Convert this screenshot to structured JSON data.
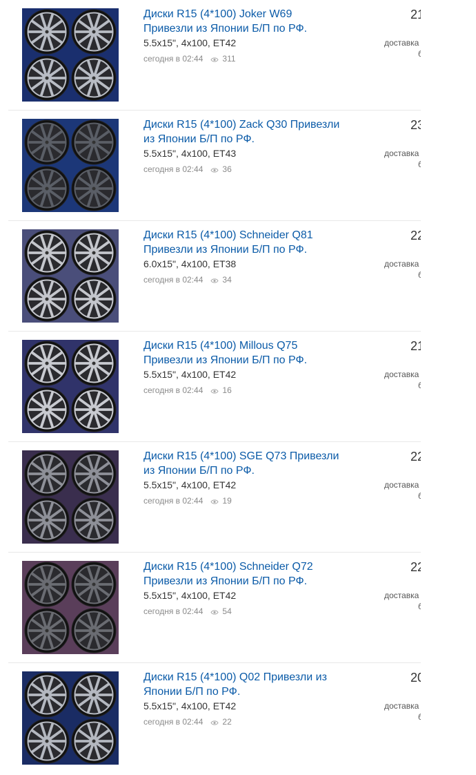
{
  "listings": [
    {
      "title": "Диски R15 (4*100) Joker W69 Привезли из Японии Б/П по РФ.",
      "params": "5.5x15\", 4x100, ET42",
      "date": "сегодня в 02:44",
      "views": "311",
      "price": "21",
      "delivery": "доставка",
      "delivery2": "б",
      "bg": "#1a2f6e",
      "rim": "#b8bcc4"
    },
    {
      "title": "Диски R15 (4*100) Zack Q30 Привезли из Японии Б/П по РФ.",
      "params": "5.5x15\", 4x100, ET43",
      "date": "сегодня в 02:44",
      "views": "36",
      "price": "23",
      "delivery": "доставка",
      "delivery2": "б",
      "bg": "#1c3778",
      "rim": "#5a5e66"
    },
    {
      "title": "Диски R15 (4*100) Schneider Q81 Привезли из Японии Б/П по РФ.",
      "params": "6.0x15\", 4x100, ET38",
      "date": "сегодня в 02:44",
      "views": "34",
      "price": "22",
      "delivery": "доставка",
      "delivery2": "б",
      "bg": "#4a4e7a",
      "rim": "#c4c6cc"
    },
    {
      "title": "Диски R15 (4*100) Millous Q75 Привезли из Японии Б/П по РФ.",
      "params": "5.5x15\", 4x100, ET42",
      "date": "сегодня в 02:44",
      "views": "16",
      "price": "21",
      "delivery": "доставка",
      "delivery2": "б",
      "bg": "#30336a",
      "rim": "#c8cad0"
    },
    {
      "title": "Диски R15 (4*100) SGE Q73 Привезли из Японии Б/П по РФ.",
      "params": "5.5x15\", 4x100, ET42",
      "date": "сегодня в 02:44",
      "views": "19",
      "price": "22",
      "delivery": "доставка",
      "delivery2": "б",
      "bg": "#3a2e4e",
      "rim": "#8e9098"
    },
    {
      "title": "Диски R15 (4*100) Schneider Q72 Привезли из Японии Б/П по РФ.",
      "params": "5.5x15\", 4x100, ET42",
      "date": "сегодня в 02:44",
      "views": "54",
      "price": "22",
      "delivery": "доставка",
      "delivery2": "б",
      "bg": "#5a3e5a",
      "rim": "#6a6c72"
    },
    {
      "title": "Диски R15 (4*100) Q02 Привезли из Японии Б/П по РФ.",
      "params": "5.5x15\", 4x100, ET42",
      "date": "сегодня в 02:44",
      "views": "22",
      "price": "20",
      "delivery": "доставка",
      "delivery2": "б",
      "bg": "#1a2c64",
      "rim": "#b4b8c0"
    }
  ],
  "icons": {
    "views": "eye-icon"
  }
}
